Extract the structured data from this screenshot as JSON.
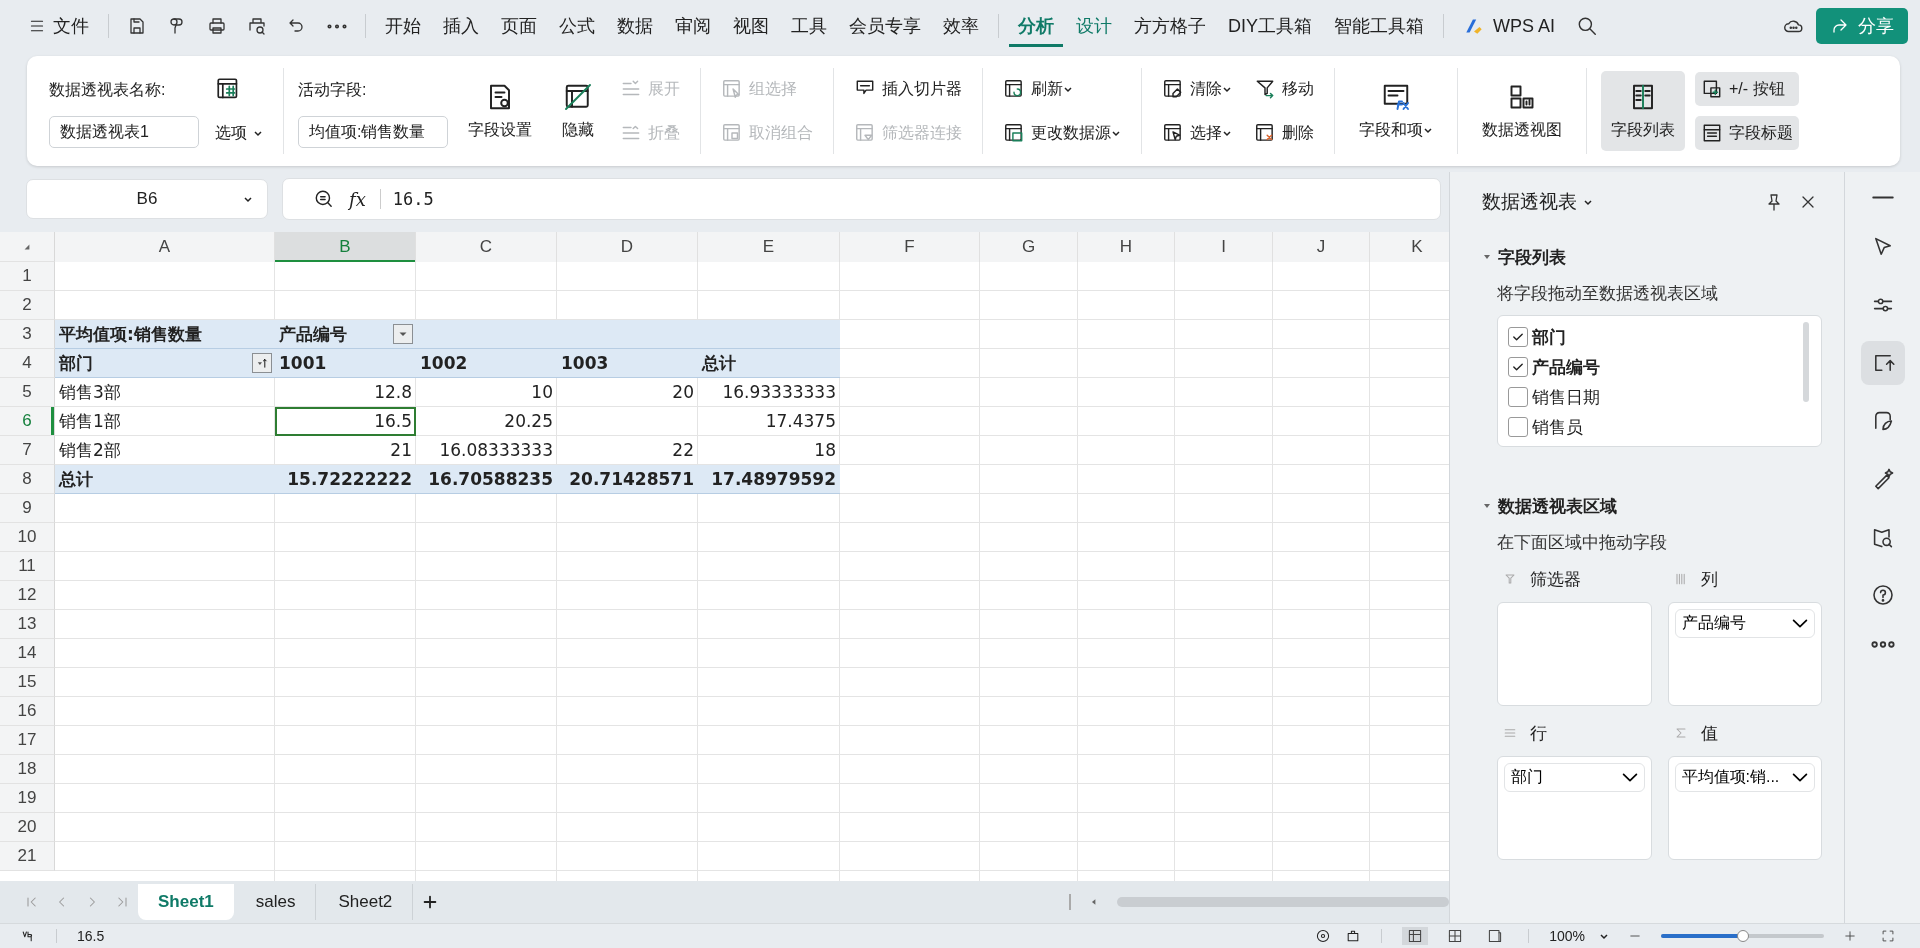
{
  "menu_bar": {
    "file_menu": "文件",
    "tabs": [
      {
        "label": "开始",
        "selected": false,
        "contextual": false
      },
      {
        "label": "插入",
        "selected": false,
        "contextual": false
      },
      {
        "label": "页面",
        "selected": false,
        "contextual": false
      },
      {
        "label": "公式",
        "selected": false,
        "contextual": false
      },
      {
        "label": "数据",
        "selected": false,
        "contextual": false
      },
      {
        "label": "审阅",
        "selected": false,
        "contextual": false
      },
      {
        "label": "视图",
        "selected": false,
        "contextual": false
      },
      {
        "label": "工具",
        "selected": false,
        "contextual": false
      },
      {
        "label": "会员专享",
        "selected": false,
        "contextual": false
      },
      {
        "label": "效率",
        "selected": false,
        "contextual": false
      },
      {
        "label": "分析",
        "selected": true,
        "contextual": true
      },
      {
        "label": "设计",
        "selected": false,
        "contextual": true
      },
      {
        "label": "方方格子",
        "selected": false,
        "contextual": false
      },
      {
        "label": "DIY工具箱",
        "selected": false,
        "contextual": false
      },
      {
        "label": "智能工具箱",
        "selected": false,
        "contextual": false
      }
    ],
    "ai_button": "WPS AI",
    "share_button": "分享"
  },
  "ribbon": [
    {
      "columns": [
        {
          "kind": "stack",
          "items": [
            {
              "kind": "label",
              "label": "数据透视表名称:"
            },
            {
              "kind": "field",
              "value": "数据透视表1"
            }
          ]
        },
        {
          "kind": "stack",
          "items": [
            {
              "kind": "icon-button"
            },
            {
              "kind": "button",
              "label": "选项",
              "dropdown": true
            }
          ]
        }
      ]
    },
    {
      "columns": [
        {
          "kind": "stack",
          "items": [
            {
              "kind": "label",
              "label": "活动字段:"
            },
            {
              "kind": "field",
              "value": "均值项:销售数量"
            }
          ]
        },
        {
          "kind": "large",
          "label": "字段设置",
          "disabled": false,
          "dropdown": false,
          "selected": false
        },
        {
          "kind": "large",
          "label": "隐藏",
          "disabled": false,
          "dropdown": false,
          "selected": false
        },
        {
          "kind": "stack",
          "items": [
            {
              "kind": "small",
              "label": "展开",
              "disabled": true,
              "dropdown": false,
              "selected": false
            },
            {
              "kind": "small",
              "label": "折叠",
              "disabled": true,
              "dropdown": false,
              "selected": false
            }
          ]
        }
      ]
    },
    {
      "columns": [
        {
          "kind": "stack",
          "items": [
            {
              "kind": "small",
              "label": "组选择",
              "disabled": true,
              "dropdown": false,
              "selected": false
            },
            {
              "kind": "small",
              "label": "取消组合",
              "disabled": true,
              "dropdown": false,
              "selected": false
            }
          ]
        }
      ]
    },
    {
      "columns": [
        {
          "kind": "stack",
          "items": [
            {
              "kind": "small",
              "label": "插入切片器",
              "disabled": false,
              "dropdown": false,
              "selected": false
            },
            {
              "kind": "small",
              "label": "筛选器连接",
              "disabled": true,
              "dropdown": false,
              "selected": false
            }
          ]
        }
      ]
    },
    {
      "columns": [
        {
          "kind": "stack",
          "items": [
            {
              "kind": "small",
              "label": "刷新",
              "disabled": false,
              "dropdown": true,
              "selected": false
            },
            {
              "kind": "small",
              "label": "更改数据源",
              "disabled": false,
              "dropdown": true,
              "selected": false
            }
          ]
        }
      ]
    },
    {
      "columns": [
        {
          "kind": "stack",
          "items": [
            {
              "kind": "small",
              "label": "清除",
              "disabled": false,
              "dropdown": true,
              "selected": false
            },
            {
              "kind": "small",
              "label": "选择",
              "disabled": false,
              "dropdown": true,
              "selected": false
            }
          ]
        },
        {
          "kind": "stack",
          "items": [
            {
              "kind": "small",
              "label": "移动",
              "disabled": false,
              "dropdown": false,
              "selected": false
            },
            {
              "kind": "small",
              "label": "删除",
              "disabled": false,
              "dropdown": false,
              "selected": false
            }
          ]
        }
      ]
    },
    {
      "columns": [
        {
          "kind": "large",
          "label": "字段和项",
          "disabled": false,
          "dropdown": true,
          "selected": false
        }
      ]
    },
    {
      "columns": [
        {
          "kind": "large",
          "label": "数据透视图",
          "disabled": false,
          "dropdown": false,
          "selected": false
        }
      ]
    },
    {
      "columns": [
        {
          "kind": "large",
          "label": "字段列表",
          "disabled": false,
          "dropdown": false,
          "selected": true
        },
        {
          "kind": "stack",
          "items": [
            {
              "kind": "small",
              "label": "+/- 按钮",
              "disabled": false,
              "dropdown": false,
              "selected": true
            },
            {
              "kind": "small",
              "label": "字段标题",
              "disabled": false,
              "dropdown": false,
              "selected": true
            }
          ]
        }
      ]
    }
  ],
  "formula_bar": {
    "name_box": "B6",
    "function_button": "fx",
    "formula": "16.5"
  },
  "sheet": {
    "columns": [
      {
        "label": "A",
        "selected": false
      },
      {
        "label": "B",
        "selected": true
      },
      {
        "label": "C",
        "selected": false
      },
      {
        "label": "D",
        "selected": false
      },
      {
        "label": "E",
        "selected": false
      },
      {
        "label": "F",
        "selected": false
      },
      {
        "label": "G",
        "selected": false
      },
      {
        "label": "H",
        "selected": false
      },
      {
        "label": "I",
        "selected": false
      },
      {
        "label": "J",
        "selected": false
      },
      {
        "label": "K",
        "selected": false
      }
    ],
    "rows": [
      {
        "number": "1",
        "selected": false,
        "kind": "empty"
      },
      {
        "number": "2",
        "selected": false,
        "kind": "empty"
      },
      {
        "number": "3",
        "selected": false,
        "kind": "header",
        "cells": [
          {
            "kind": "text",
            "text": "平均值项:销售数量",
            "selected": false
          },
          {
            "kind": "dropdown",
            "text": "产品编号",
            "selected": false
          },
          {
            "kind": "text",
            "selected": false
          },
          {
            "kind": "text",
            "selected": false
          },
          {
            "kind": "text",
            "selected": false
          }
        ]
      },
      {
        "number": "4",
        "selected": false,
        "kind": "header",
        "cells": [
          {
            "kind": "sort",
            "text": "部门",
            "selected": false
          },
          {
            "kind": "text",
            "text": "1001",
            "selected": false
          },
          {
            "kind": "text",
            "text": "1002",
            "selected": false
          },
          {
            "kind": "text",
            "text": "1003",
            "selected": false
          },
          {
            "kind": "text",
            "text": "总计",
            "selected": false
          }
        ]
      },
      {
        "number": "5",
        "selected": false,
        "kind": "data",
        "cells": [
          {
            "kind": "text",
            "text": "销售3部",
            "selected": false
          },
          {
            "kind": "text",
            "text": "12.8",
            "selected": false
          },
          {
            "kind": "text",
            "text": "10",
            "selected": false
          },
          {
            "kind": "text",
            "text": "20",
            "selected": false
          },
          {
            "kind": "text",
            "text": "16.93333333",
            "selected": false
          }
        ]
      },
      {
        "number": "6",
        "selected": true,
        "kind": "data",
        "cells": [
          {
            "kind": "text",
            "text": "销售1部",
            "selected": false
          },
          {
            "kind": "text",
            "text": "16.5",
            "selected": true
          },
          {
            "kind": "text",
            "text": "20.25",
            "selected": false
          },
          {
            "kind": "text",
            "selected": false
          },
          {
            "kind": "text",
            "text": "17.4375",
            "selected": false
          }
        ]
      },
      {
        "number": "7",
        "selected": false,
        "kind": "data",
        "cells": [
          {
            "kind": "text",
            "text": "销售2部",
            "selected": false
          },
          {
            "kind": "text",
            "text": "21",
            "selected": false
          },
          {
            "kind": "text",
            "text": "16.08333333",
            "selected": false
          },
          {
            "kind": "text",
            "text": "22",
            "selected": false
          },
          {
            "kind": "text",
            "text": "18",
            "selected": false
          }
        ]
      },
      {
        "number": "8",
        "selected": false,
        "kind": "total",
        "cells": [
          {
            "kind": "text",
            "text": "总计",
            "selected": false
          },
          {
            "kind": "text",
            "text": "15.72222222",
            "selected": false
          },
          {
            "kind": "text",
            "text": "16.70588235",
            "selected": false
          },
          {
            "kind": "text",
            "text": "20.71428571",
            "selected": false
          },
          {
            "kind": "text",
            "text": "17.48979592",
            "selected": false
          }
        ]
      },
      {
        "number": "9",
        "selected": false,
        "kind": "empty"
      },
      {
        "number": "10",
        "selected": false,
        "kind": "empty"
      },
      {
        "number": "11",
        "selected": false,
        "kind": "empty"
      },
      {
        "number": "12",
        "selected": false,
        "kind": "empty"
      },
      {
        "number": "13",
        "selected": false,
        "kind": "empty"
      },
      {
        "number": "14",
        "selected": false,
        "kind": "empty"
      },
      {
        "number": "15",
        "selected": false,
        "kind": "empty"
      },
      {
        "number": "16",
        "selected": false,
        "kind": "empty"
      },
      {
        "number": "17",
        "selected": false,
        "kind": "empty"
      },
      {
        "number": "18",
        "selected": false,
        "kind": "empty"
      },
      {
        "number": "19",
        "selected": false,
        "kind": "empty"
      },
      {
        "number": "20",
        "selected": false,
        "kind": "empty"
      },
      {
        "number": "21",
        "selected": false,
        "kind": "empty"
      }
    ]
  },
  "sheet_tabs": [
    {
      "label": "Sheet1",
      "selected": true
    },
    {
      "label": "sales",
      "selected": false
    },
    {
      "label": "Sheet2",
      "selected": false
    }
  ],
  "pivot_panel": {
    "title": "数据透视表",
    "field_section": {
      "title": "字段列表",
      "expanded": true,
      "hint": "将字段拖动至数据透视表区域",
      "fields": [
        {
          "label": "部门",
          "checked": true
        },
        {
          "label": "产品编号",
          "checked": true
        },
        {
          "label": "销售日期",
          "checked": false
        },
        {
          "label": "销售员",
          "checked": false
        }
      ]
    },
    "area_section": {
      "title": "数据透视表区域",
      "expanded": true,
      "hint": "在下面区域中拖动字段",
      "areas": [
        {
          "kind": "filter",
          "label": "筛选器"
        },
        {
          "kind": "columns",
          "label": "列",
          "fields": [
            {
              "label": "产品编号"
            }
          ]
        },
        {
          "kind": "rows",
          "label": "行",
          "fields": [
            {
              "label": "部门"
            }
          ]
        },
        {
          "kind": "values",
          "label": "值",
          "fields": [
            {
              "label": "平均值项:销..."
            }
          ]
        }
      ]
    }
  },
  "side_rail": [
    {
      "kind": "collapse",
      "selected": false
    },
    {
      "kind": "cursor",
      "selected": false
    },
    {
      "kind": "sliders",
      "selected": false
    },
    {
      "kind": "pivot",
      "selected": true
    },
    {
      "kind": "leaf",
      "selected": false
    },
    {
      "kind": "wand",
      "selected": false
    },
    {
      "kind": "book-search",
      "selected": false
    },
    {
      "kind": "help",
      "selected": false
    },
    {
      "kind": "more",
      "selected": false
    }
  ],
  "status_bar": {
    "cell_value": "16.5",
    "views": [
      {
        "kind": "normal",
        "selected": true
      },
      {
        "kind": "page-break",
        "selected": false
      },
      {
        "kind": "page-layout",
        "selected": false
      }
    ],
    "zoom": "100%",
    "zoom_slider": {
      "level": 0.5
    }
  }
}
